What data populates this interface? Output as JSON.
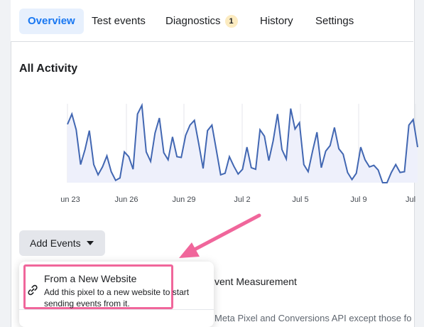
{
  "tabs": [
    {
      "label": "Overview",
      "active": true
    },
    {
      "label": "Test events"
    },
    {
      "label": "Diagnostics",
      "badge": "1"
    },
    {
      "label": "History"
    },
    {
      "label": "Settings"
    }
  ],
  "section_title": "All Activity",
  "chart_data": {
    "type": "area",
    "title": "",
    "xlabel": "",
    "ylabel": "",
    "x_tick_labels": [
      "un 23",
      "Jun 26",
      "Jun 29",
      "Jul 2",
      "Jul 5",
      "Jul 9",
      "Jul"
    ],
    "x": [
      0,
      1,
      2,
      3,
      4,
      5,
      6,
      7,
      8,
      9,
      10,
      11,
      12,
      13,
      14,
      15,
      16,
      17,
      18,
      19,
      20,
      21,
      22,
      23,
      24,
      25,
      26,
      27,
      28,
      29,
      30,
      31,
      32,
      33,
      34,
      35,
      36,
      37,
      38,
      39,
      40,
      41,
      42,
      43,
      44,
      45,
      46,
      47,
      48,
      49,
      50,
      51,
      52,
      53,
      54,
      55,
      56,
      57,
      58,
      59,
      60,
      61,
      62,
      63,
      64,
      65,
      66,
      67,
      68,
      69,
      70,
      71,
      72,
      73,
      74,
      75,
      76,
      77,
      78,
      79,
      80
    ],
    "series": [
      {
        "values": [
          74,
          87,
          67,
          23,
          42,
          66,
          23,
          10,
          20,
          34,
          14,
          3,
          6,
          39,
          33,
          17,
          87,
          98,
          39,
          27,
          63,
          82,
          38,
          29,
          58,
          33,
          32,
          60,
          73,
          79,
          49,
          18,
          66,
          73,
          42,
          10,
          12,
          33,
          21,
          11,
          17,
          45,
          19,
          17,
          67,
          59,
          28,
          53,
          87,
          42,
          30,
          94,
          68,
          76,
          23,
          14,
          40,
          64,
          19,
          40,
          47,
          70,
          43,
          36,
          13,
          4,
          12,
          45,
          29,
          20,
          22,
          16,
          0,
          0,
          13,
          23,
          13,
          14,
          73,
          80,
          45
        ],
        "color": "#4267b2",
        "fill": "#eef0fb"
      }
    ],
    "ylim": [
      0,
      100
    ],
    "grid": true
  },
  "add_events": {
    "label": "Add Events"
  },
  "dropdown": {
    "item_title": "From a New Website",
    "item_desc": "Add this pixel to a new website to start sending events from it."
  },
  "background": {
    "line1": "vent Measurement",
    "line2": "Meta Pixel and Conversions API except those fo"
  },
  "colors": {
    "accent": "#1877f2",
    "highlight": "#f0669b",
    "badge": "#fcebc0"
  },
  "icons": {
    "menu_item": "link-icon",
    "add_events": "caret-down-icon"
  }
}
